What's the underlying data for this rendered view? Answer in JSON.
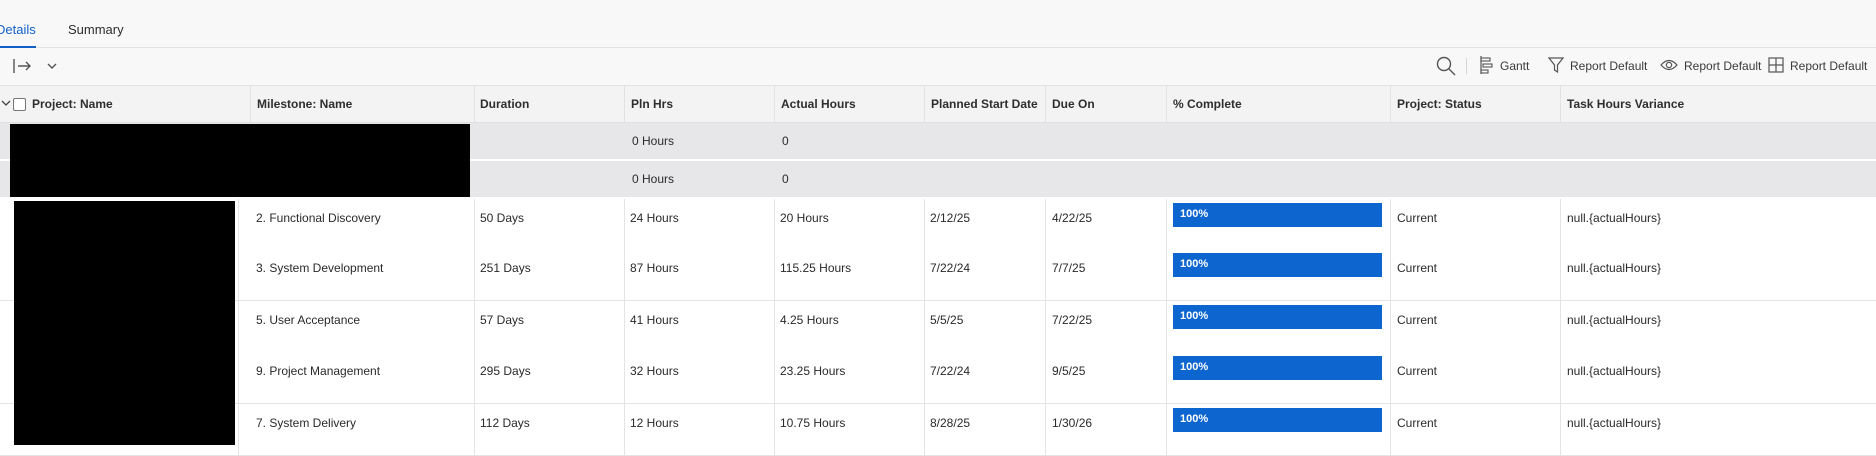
{
  "tabs": [
    {
      "label": "Details",
      "active": true
    },
    {
      "label": "Summary",
      "active": false
    }
  ],
  "toolbar": {
    "gantt_label": "Gantt",
    "filter_label": "Report Default",
    "view_label": "Report Default",
    "grouping_label": "Report Default"
  },
  "columns": [
    "Project: Name",
    "Milestone: Name",
    "Duration",
    "Pln Hrs",
    "Actual Hours",
    "Planned Start Date",
    "Due On",
    "% Complete",
    "Project: Status",
    "Task Hours Variance"
  ],
  "group_rows": [
    {
      "pln_hrs": "0 Hours",
      "actual_hours": "0"
    },
    {
      "pln_hrs": "0 Hours",
      "actual_hours": "0"
    }
  ],
  "rows": [
    {
      "milestone": "2. Functional Discovery",
      "duration": "50 Days",
      "pln_hrs": "24 Hours",
      "actual_hours": "20 Hours",
      "start": "2/12/25",
      "due": "4/22/25",
      "complete": "100%",
      "complete_value": 1.0,
      "status": "Current",
      "variance": "null.{actualHours}"
    },
    {
      "milestone": "3. System Development",
      "duration": "251 Days",
      "pln_hrs": "87 Hours",
      "actual_hours": "115.25 Hours",
      "start": "7/22/24",
      "due": "7/7/25",
      "complete": "100%",
      "complete_value": 1.0,
      "status": "Current",
      "variance": "null.{actualHours}"
    },
    {
      "milestone": "5. User Acceptance",
      "duration": "57 Days",
      "pln_hrs": "41 Hours",
      "actual_hours": "4.25 Hours",
      "start": "5/5/25",
      "due": "7/22/25",
      "complete": "100%",
      "complete_value": 1.0,
      "status": "Current",
      "variance": "null.{actualHours}"
    },
    {
      "milestone": "9. Project Management",
      "duration": "295 Days",
      "pln_hrs": "32 Hours",
      "actual_hours": "23.25 Hours",
      "start": "7/22/24",
      "due": "9/5/25",
      "complete": "100%",
      "complete_value": 1.0,
      "status": "Current",
      "variance": "null.{actualHours}"
    },
    {
      "milestone": "7. System Delivery",
      "duration": "112 Days",
      "pln_hrs": "12 Hours",
      "actual_hours": "10.75 Hours",
      "start": "8/28/25",
      "due": "1/30/26",
      "complete": "100%",
      "complete_value": 1.0,
      "status": "Current",
      "variance": "null.{actualHours}"
    }
  ],
  "colors": {
    "accent": "#1160c7",
    "progress": "#0d66d0",
    "group_row_bg": "#e7e7e9",
    "redaction": "#000000"
  }
}
